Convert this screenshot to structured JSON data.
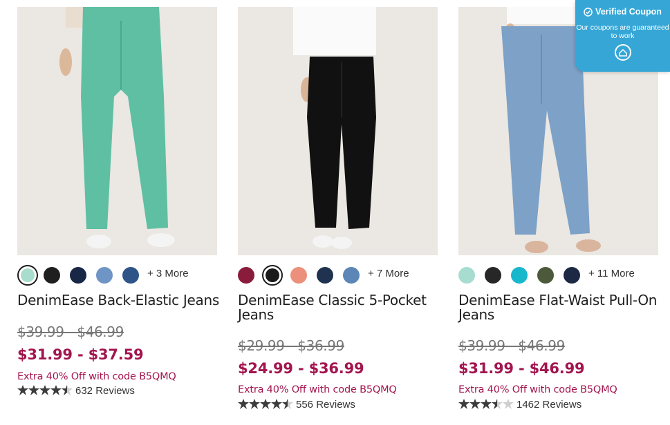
{
  "products": [
    {
      "title": "DenimEase Back-Elastic Jeans",
      "swatch_colors": [
        "#a8dccd",
        "#1f1f1f",
        "#182746",
        "#6e95c5",
        "#2f5487"
      ],
      "more_label": "+ 3 More",
      "original_price": "$39.99 - $46.99",
      "sale_price": "$31.99 - $37.59",
      "promo": "Extra 40% Off with code B5QMQ",
      "rating": 4.5,
      "reviews": "632 Reviews"
    },
    {
      "title": "DenimEase Classic 5-Pocket Jeans",
      "swatch_colors": [
        "#8a1c3b",
        "#1a1a1a",
        "#ec907b",
        "#1f3350",
        "#5b86b5"
      ],
      "more_label": "+ 7 More",
      "original_price": "$29.99 - $36.99",
      "sale_price": "$24.99 - $36.99",
      "promo": "Extra 40% Off with code B5QMQ",
      "rating": 4.5,
      "reviews": "556 Reviews"
    },
    {
      "title": "DenimEase Flat-Waist Pull-On Jeans",
      "swatch_colors": [
        "#a6ddd0",
        "#272727",
        "#17b7cc",
        "#4c5a3b",
        "#1c2844"
      ],
      "more_label": "+ 11 More",
      "original_price": "$39.99 - $46.99",
      "sale_price": "$31.99 - $46.99",
      "promo": "Extra 40% Off with code B5QMQ",
      "rating": 3.5,
      "reviews": "1462 Reviews"
    }
  ],
  "coupon": {
    "title": "Verified Coupon",
    "subtitle": "Our coupons are guaranteed to work"
  },
  "colors": {
    "accent": "#a3154f",
    "coupon_bg": "#35a6d6",
    "star": "#3c3c3c"
  }
}
